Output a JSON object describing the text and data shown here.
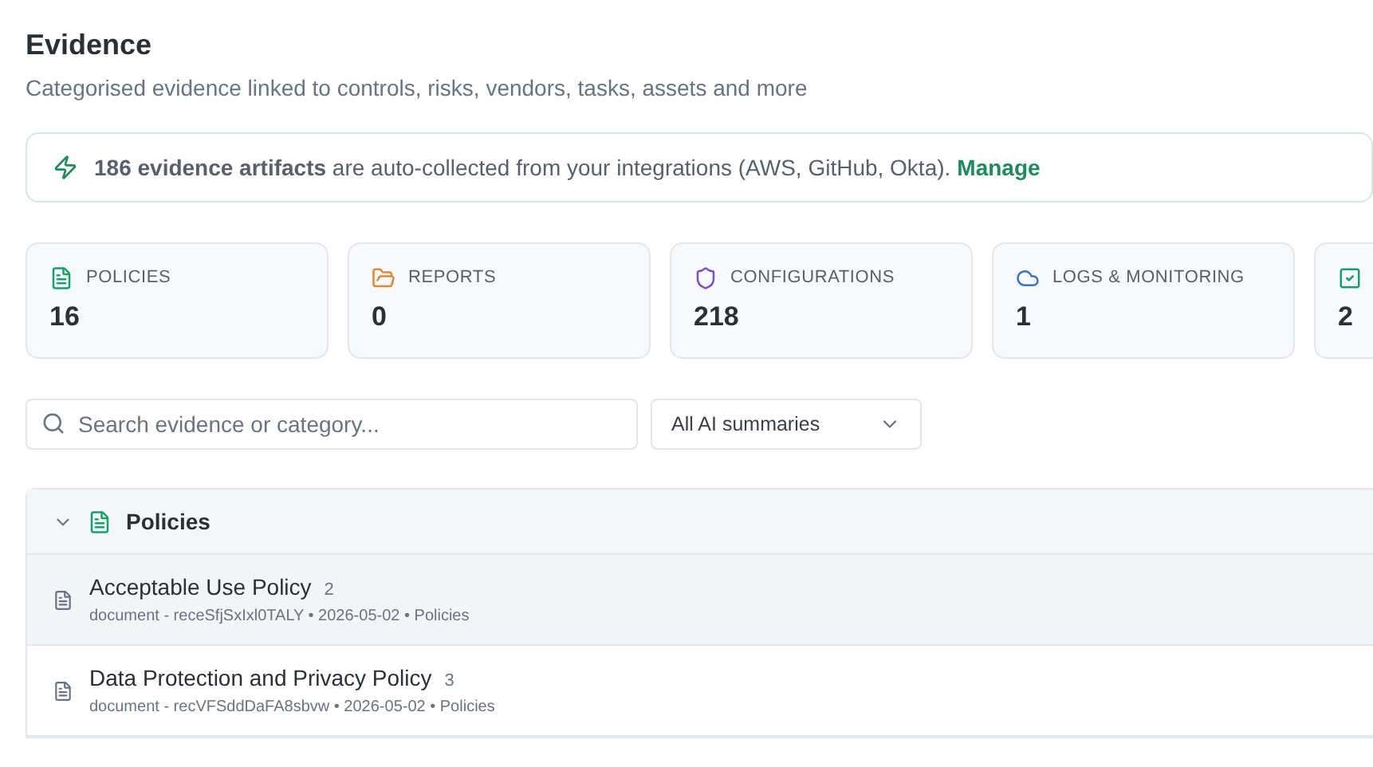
{
  "header": {
    "title": "Evidence",
    "subtitle": "Categorised evidence linked to controls, risks, vendors, tasks, assets and more"
  },
  "banner": {
    "text": "**186 evidence artifacts** are auto-collected from your integrations (AWS, GitHub, Okta).",
    "link": "Manage"
  },
  "stats": [
    {
      "label": "POLICIES",
      "value": "16",
      "color": "#16a06a"
    },
    {
      "label": "REPORTS",
      "value": "0",
      "color": "#e0883a"
    },
    {
      "label": "CONFIGURATIONS",
      "value": "218",
      "color": "#7b4fc4"
    },
    {
      "label": "LOGS & MONITORING",
      "value": "1",
      "color": "#3b6fd0"
    },
    {
      "value": "2",
      "color": "#16a06a"
    }
  ],
  "search": {
    "placeholder": "Search evidence or category..."
  },
  "filter": {
    "value": "All AI summaries"
  },
  "groups": [
    {
      "title": "Policies",
      "expanded": true,
      "items": [
        {
          "title": "Acceptable Use Policy",
          "count": "2",
          "meta": "document - receSfjSxIxl0TALY • 2026-05-02 • Policies",
          "hovered": true
        },
        {
          "title": "Data Protection and Privacy Policy",
          "count": "3",
          "meta": "document - recVFSddDaFA8sbvw • 2026-05-02 • Policies",
          "hovered": false
        }
      ]
    }
  ]
}
